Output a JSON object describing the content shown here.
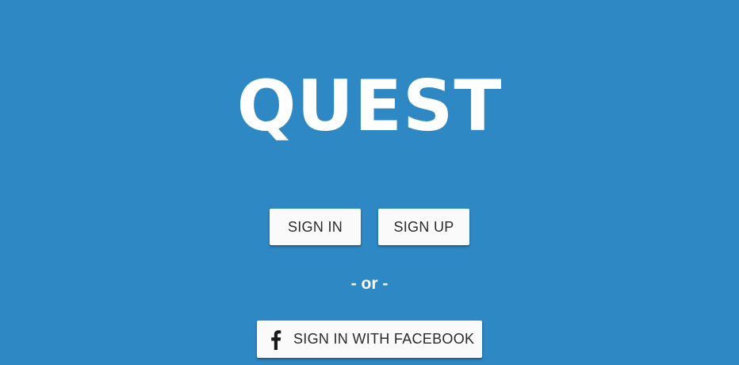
{
  "app": {
    "logo_text": "QUEST",
    "background_color": "#2e88c4"
  },
  "auth": {
    "sign_in_label": "SIGN IN",
    "sign_up_label": "SIGN UP",
    "separator_text": "- or -",
    "facebook_label": "SIGN IN WITH FACEBOOK",
    "facebook_icon": "facebook-f-icon"
  }
}
